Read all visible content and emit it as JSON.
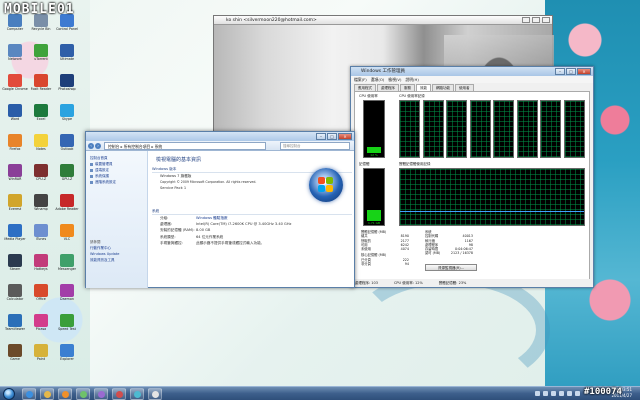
{
  "watermark": {
    "logo": "MOBILE01",
    "id": "#100074"
  },
  "desktop_icons": [
    {
      "label": "Computer",
      "color": "#4a7fbf"
    },
    {
      "label": "Recycle Bin",
      "color": "#7a8fa8"
    },
    {
      "label": "Control Panel",
      "color": "#3d7ad1"
    },
    {
      "label": "Network",
      "color": "#5a87c0"
    },
    {
      "label": "uTorrent",
      "color": "#3fa33c"
    },
    {
      "label": "Ultimate",
      "color": "#2f5fa8"
    },
    {
      "label": "Google Chrome",
      "color": "#e24b3b"
    },
    {
      "label": "Foxit Reader",
      "color": "#d9462f"
    },
    {
      "label": "Photoshop",
      "color": "#1e3f7a"
    },
    {
      "label": "Word",
      "color": "#2a5da8"
    },
    {
      "label": "Excel",
      "color": "#1d7a3d"
    },
    {
      "label": "Skype",
      "color": "#2aa3e0"
    },
    {
      "label": "Firefox",
      "color": "#e8842a"
    },
    {
      "label": "Notes",
      "color": "#f3d23b"
    },
    {
      "label": "Outlook",
      "color": "#3466b3"
    },
    {
      "label": "WinRAR",
      "color": "#8a3f98"
    },
    {
      "label": "CPU-Z",
      "color": "#7d2f2f"
    },
    {
      "label": "GPU-Z",
      "color": "#2f7d3a"
    },
    {
      "label": "Everest",
      "color": "#d1a52b"
    },
    {
      "label": "Winamp",
      "color": "#444444"
    },
    {
      "label": "Adobe Reader",
      "color": "#c62828"
    },
    {
      "label": "Media Player",
      "color": "#2d6fc4"
    },
    {
      "label": "iTunes",
      "color": "#6d8fd0"
    },
    {
      "label": "VLC",
      "color": "#f08a1c"
    },
    {
      "label": "Steam",
      "color": "#2b3a4f"
    },
    {
      "label": "Hotkeys",
      "color": "#c23b7a"
    },
    {
      "label": "Messenger",
      "color": "#3fa06a"
    },
    {
      "label": "Calculator",
      "color": "#5b5b5b"
    },
    {
      "label": "Office",
      "color": "#d84a2b"
    },
    {
      "label": "Daemon",
      "color": "#a23da8"
    },
    {
      "label": "TeamViewer",
      "color": "#2b6fb8"
    },
    {
      "label": "Picasa",
      "color": "#d33c8b"
    },
    {
      "label": "Speed Test",
      "color": "#3a9e3a"
    },
    {
      "label": "Game",
      "color": "#6b4a2a"
    },
    {
      "label": "Paint",
      "color": "#d6b23a"
    },
    {
      "label": "Explorer",
      "color": "#3a7fd1"
    }
  ],
  "photo_window": {
    "title": "ko shin <silvermoon220@hotmail.com>"
  },
  "task_manager": {
    "title": "Windows 工作管理員",
    "menu": [
      "檔案(F)",
      "選項(O)",
      "檢視(V)",
      "說明(H)"
    ],
    "tabs": [
      "應用程式",
      "處理程序",
      "服務",
      "效能",
      "網路功能",
      "使用者"
    ],
    "active_tab": "效能",
    "cpu_usage_label": "CPU 使用率",
    "cpu_history_label": "CPU 使用率記錄",
    "cpu_value": "12 %",
    "cpu_fill": 0.12,
    "memory_label": "記憶體",
    "memory_history_label": "實體記憶體使用記錄",
    "memory_value": "1.71 GB",
    "memory_fill": 0.22,
    "physical_header": "實體記憶體 (MB)",
    "physical_rows": [
      [
        "總共",
        "8190"
      ],
      [
        "快取的",
        "2177"
      ],
      [
        "可用",
        "6242"
      ],
      [
        "未使用",
        "4074"
      ]
    ],
    "system_header": "系統",
    "system_rows": [
      [
        "控制代碼",
        "40013"
      ],
      [
        "執行緒",
        "1167"
      ],
      [
        "處理程序",
        "98"
      ],
      [
        "存留時間",
        "0:04:06:47"
      ],
      [
        "認可 (MB)",
        "2123 / 16378"
      ]
    ],
    "kernel_header": "核心記憶體 (MB)",
    "kernel_rows": [
      [
        "已分頁",
        "222"
      ],
      [
        "非分頁",
        "94"
      ]
    ],
    "resource_button": "資源監視器(R)...",
    "status": [
      "處理程序: 103",
      "CPU 使用率: 12%",
      "實體記憶體: 23%"
    ]
  },
  "system_window": {
    "address": "控制台 ▸ 所有控制台項目 ▸ 系統",
    "search_placeholder": "搜尋控制台",
    "sidebar_links": [
      "控制台首頁",
      "裝置管理員",
      "遠端設定",
      "系統保護",
      "進階系統設定"
    ],
    "sidebar_see_also": "請參閱",
    "sidebar_bottom": [
      "行動作業中心",
      "Windows Update",
      "效能資訊及工具"
    ],
    "heading": "檢視電腦的基本資訊",
    "edition_head": "Windows 版本",
    "edition_lines": [
      "Windows 7 旗艦版",
      "Copyright © 2009 Microsoft Corporation. All rights reserved.",
      "Service Pack 1"
    ],
    "system_head": "系統",
    "rating_label": "分級:",
    "rating_value": "Windows 體驗指數",
    "processor_label": "處理器:",
    "processor_value": "Intel(R) Core(TM) i7-2600K CPU @ 3.40GHz   3.40 GHz",
    "ram_label": "安裝的記憶體 (RAM):",
    "ram_value": "8.00 GB",
    "type_label": "系統類型:",
    "type_value": "64 位元作業系統",
    "pen_label": "手寫筆與觸控:",
    "pen_value": "此顯示器不提供手寫筆或觸控式輸入功能。"
  },
  "taskbar": {
    "time": "下午 03:51",
    "date": "2011/4/27"
  }
}
